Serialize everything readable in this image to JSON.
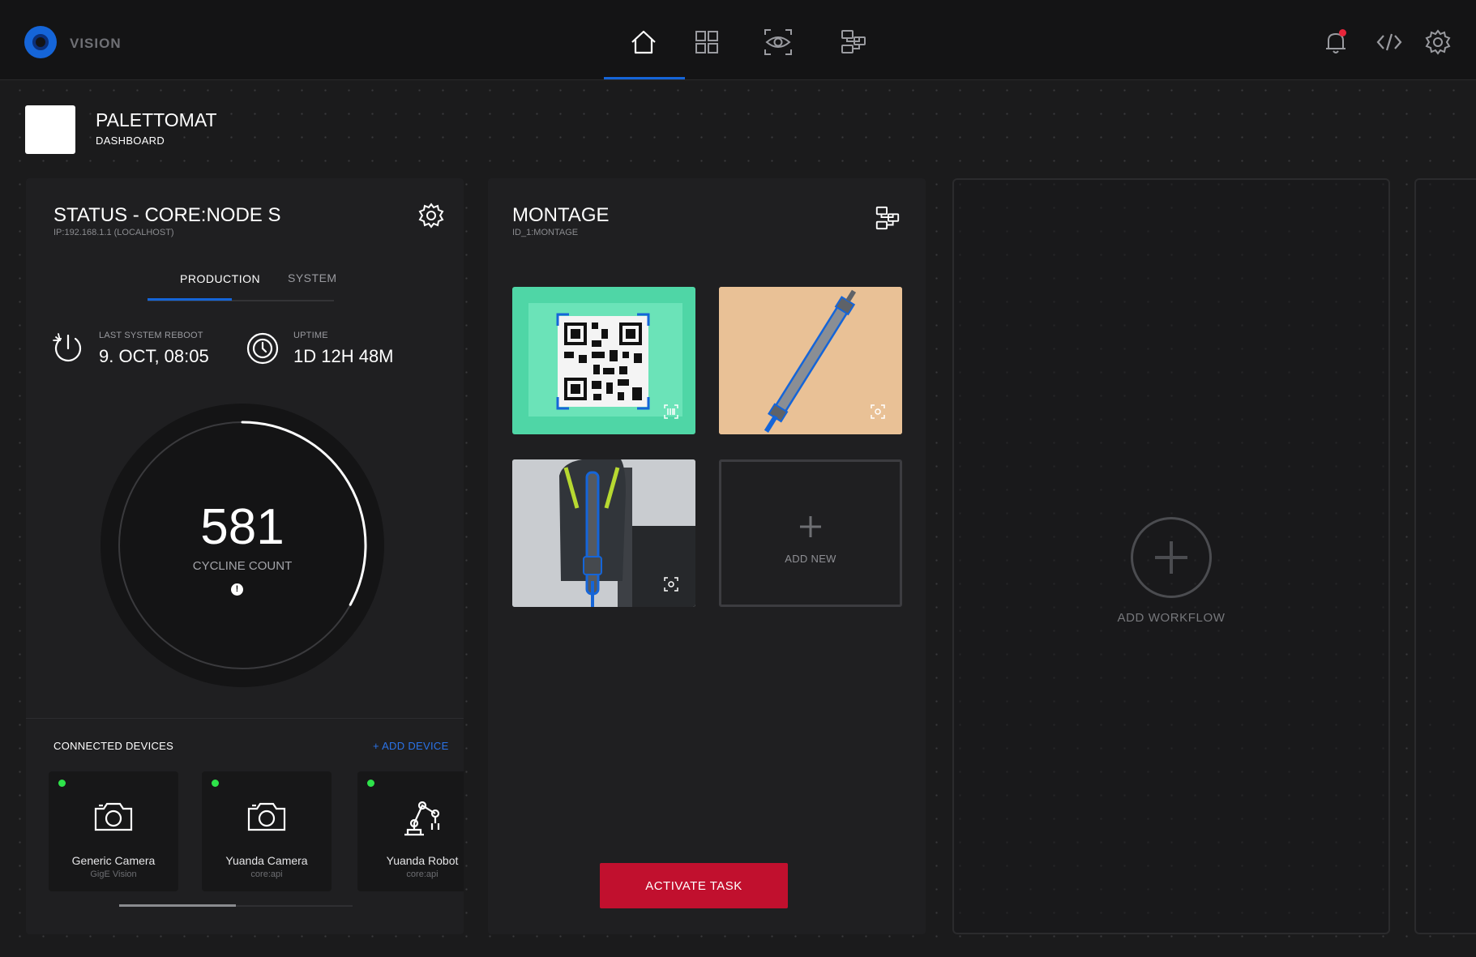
{
  "app": {
    "name": "VISION"
  },
  "nav": {
    "items": [
      "home",
      "grid",
      "vision",
      "workflow"
    ],
    "active": "home"
  },
  "topbar_right": {
    "notifications_unread": true
  },
  "project": {
    "title": "PALETTOMAT",
    "subtitle": "DASHBOARD"
  },
  "status_card": {
    "title": "STATUS - CORE:NODE S",
    "subtitle": "IP:192.168.1.1 (LOCALHOST)",
    "tabs": [
      {
        "label": "PRODUCTION",
        "active": true
      },
      {
        "label": "SYSTEM",
        "active": false
      }
    ],
    "last_reboot": {
      "label": "LAST SYSTEM REBOOT",
      "value": "9. OCT, 08:05"
    },
    "uptime": {
      "label": "UPTIME",
      "value": "1D 12H 48M"
    },
    "gauge": {
      "value": "581",
      "label": "CYCLINE COUNT",
      "alert_glyph": "!",
      "progress": 0.33
    },
    "devices": {
      "title": "CONNECTED DEVICES",
      "add_label": "+ ADD DEVICE",
      "items": [
        {
          "name": "Generic Camera",
          "protocol": "GigE Vision",
          "status": "online",
          "icon": "camera-icon"
        },
        {
          "name": "Yuanda Camera",
          "protocol": "core:api",
          "status": "online",
          "icon": "camera-icon"
        },
        {
          "name": "Yuanda Robot",
          "protocol": "core:api",
          "status": "online",
          "icon": "robot-arm-icon"
        }
      ],
      "scroll_fraction": 0.5
    }
  },
  "montage_card": {
    "title": "MONTAGE",
    "subtitle": "ID_1:MONTAGE",
    "tiles": [
      {
        "kind": "qr-code-scan",
        "background": "#4fd6a6"
      },
      {
        "kind": "cylinder-part",
        "background": "#e9c196"
      },
      {
        "kind": "spray-gun-part",
        "background": "#c5c8cc"
      }
    ],
    "add_new_label": "ADD NEW",
    "activate_label": "ACTIVATE TASK"
  },
  "workflow": {
    "add_label": "ADD WORKFLOW"
  },
  "colors": {
    "accent": "#1565d8",
    "danger": "#c1102e",
    "online": "#2ee34a",
    "background": "#1b1b1c",
    "card": "#1f1f21"
  }
}
